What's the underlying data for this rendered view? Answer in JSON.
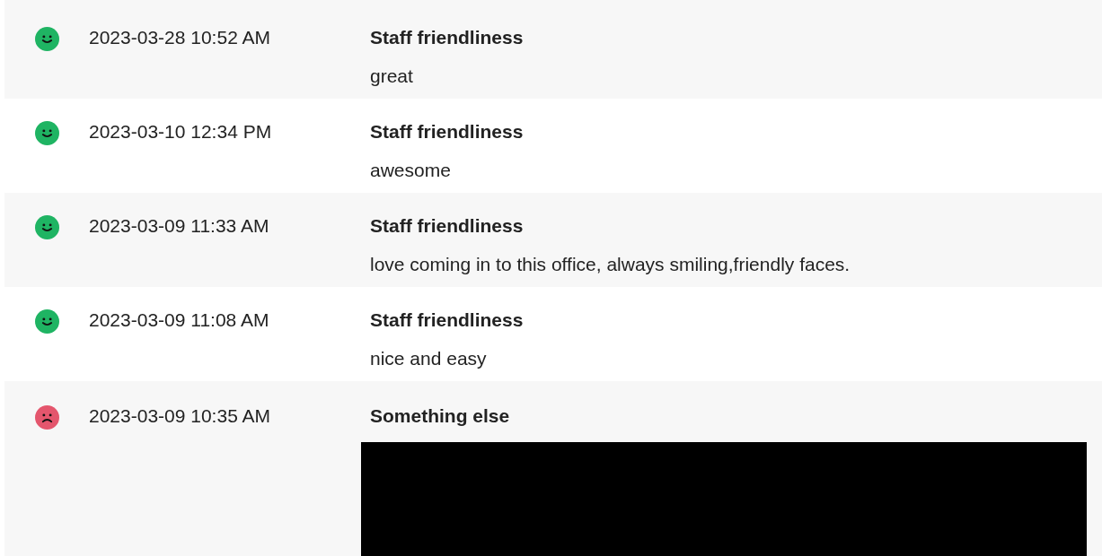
{
  "feedback": [
    {
      "kind": "happy",
      "time": "2023-03-28 10:52 AM",
      "topic": "Staff friendliness",
      "comment": "great",
      "redacted": false
    },
    {
      "kind": "happy",
      "time": "2023-03-10 12:34 PM",
      "topic": "Staff friendliness",
      "comment": "awesome",
      "redacted": false
    },
    {
      "kind": "happy",
      "time": "2023-03-09 11:33 AM",
      "topic": "Staff friendliness",
      "comment": "love coming in to this office, always smiling,friendly faces.",
      "redacted": false
    },
    {
      "kind": "happy",
      "time": "2023-03-09 11:08 AM",
      "topic": "Staff friendliness",
      "comment": "nice and easy",
      "redacted": false
    },
    {
      "kind": "sad",
      "time": "2023-03-09 10:35 AM",
      "topic": "Something else",
      "redacted": true
    }
  ]
}
